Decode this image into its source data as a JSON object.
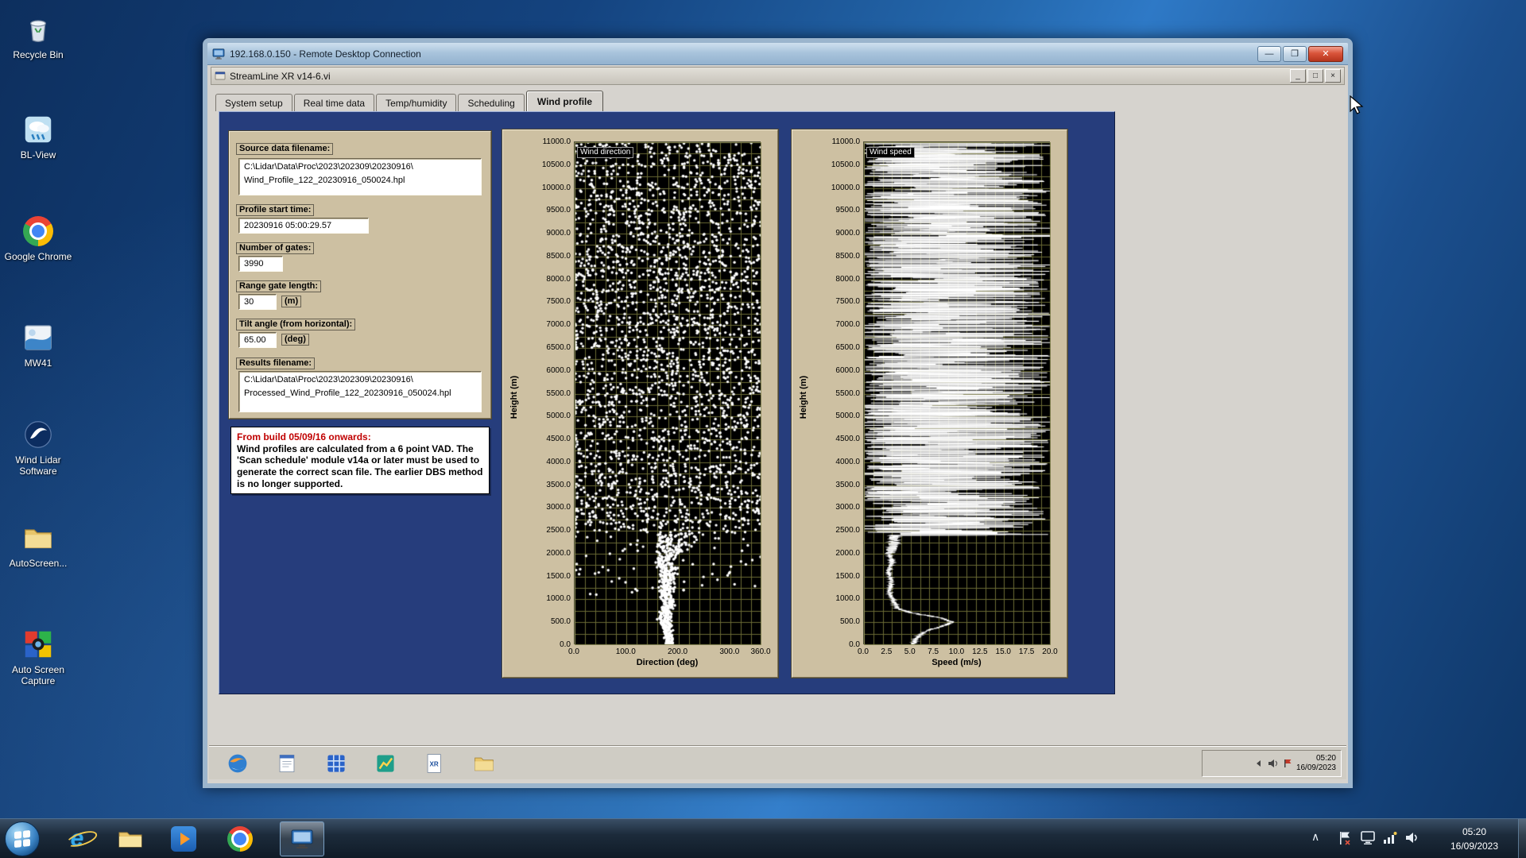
{
  "desktop": {
    "icons": [
      {
        "name": "recycle-bin",
        "label": "Recycle Bin"
      },
      {
        "name": "bl-view",
        "label": "BL-View"
      },
      {
        "name": "google-chrome",
        "label": "Google Chrome"
      },
      {
        "name": "mw41",
        "label": "MW41"
      },
      {
        "name": "wind-lidar-software",
        "label": "Wind Lidar Software"
      },
      {
        "name": "autoscreen",
        "label": "AutoScreen..."
      },
      {
        "name": "auto-screen-capture",
        "label": "Auto Screen Capture"
      }
    ]
  },
  "rdp": {
    "title": "192.168.0.150 - Remote Desktop Connection"
  },
  "app": {
    "title": "StreamLine XR v14-6.vi",
    "tabs": [
      {
        "label": "System setup"
      },
      {
        "label": "Real time data"
      },
      {
        "label": "Temp/humidity"
      },
      {
        "label": "Scheduling"
      },
      {
        "label": "Wind profile"
      }
    ],
    "fields": {
      "source_label": "Source data filename:",
      "source_value": "C:\\Lidar\\Data\\Proc\\2023\\202309\\20230916\\\nWind_Profile_122_20230916_050024.hpl",
      "start_label": "Profile start time:",
      "start_value": "20230916 05:00:29.57",
      "gates_label": "Number of gates:",
      "gates_value": "3990",
      "range_label": "Range gate length:",
      "range_value": "30",
      "range_unit": "(m)",
      "tilt_label": "Tilt angle (from horizontal):",
      "tilt_value": "65.00",
      "tilt_unit": "(deg)",
      "results_label": "Results filename:",
      "results_value": "C:\\Lidar\\Data\\Proc\\2023\\202309\\20230916\\\nProcessed_Wind_Profile_122_20230916_050024.hpl"
    },
    "notice": {
      "heading": "From build 05/09/16 onwards:",
      "body": "Wind profiles are calculated from a 6 point VAD. The 'Scan schedule' module v14a or later must be used to generate the correct scan file. The earlier DBS method is no longer supported."
    }
  },
  "chart_data": [
    {
      "type": "scatter",
      "title": "Wind direction",
      "xlabel": "Direction (deg)",
      "ylabel": "Height (m)",
      "xlim": [
        0,
        360
      ],
      "ylim": [
        0,
        11000
      ],
      "xticks": [
        0,
        100,
        200,
        300,
        360
      ],
      "ytick_step": 500,
      "xgrid_step": 20,
      "ygrid_step": 250,
      "grid": true,
      "description": "Random wind directions 0-360 deg above ~2500 m (noise); coherent column near 170-190 deg below 2500 m down to surface",
      "gen": {
        "seed": 7,
        "n_upper": 2600,
        "upper_min_height": 2450,
        "outliers": 70,
        "column_center": [
          [
            0,
            185
          ],
          [
            300,
            178
          ],
          [
            600,
            172
          ],
          [
            900,
            180
          ],
          [
            1200,
            176
          ],
          [
            1500,
            182
          ],
          [
            1800,
            174
          ],
          [
            2100,
            186
          ],
          [
            2450,
            194
          ]
        ],
        "column_width": [
          [
            0,
            8
          ],
          [
            1000,
            9
          ],
          [
            1500,
            11
          ],
          [
            2000,
            18
          ],
          [
            2450,
            34
          ]
        ]
      }
    },
    {
      "type": "line",
      "title": "Wind speed",
      "xlabel": "Speed (m/s)",
      "ylabel": "Height (m)",
      "xlim": [
        0,
        20
      ],
      "ylim": [
        0,
        11000
      ],
      "xticks": [
        0,
        2.5,
        5,
        7.5,
        10,
        12.5,
        15,
        17.5,
        20
      ],
      "ytick_step": 500,
      "xgrid_step": 1,
      "ygrid_step": 250,
      "grid": true,
      "description": "Noisy speeds spanning 0-20 m/s above ~2400 m; smooth low-level profile ~3 m/s from 800-2400 m peaking ~9.5 m/s near 500 m",
      "gen": {
        "seed": 12,
        "noise_min_height": 2400,
        "step": 4,
        "profile": [
          [
            0,
            5.2
          ],
          [
            150,
            5.6
          ],
          [
            300,
            6.5
          ],
          [
            400,
            8.3
          ],
          [
            500,
            9.4
          ],
          [
            600,
            8.2
          ],
          [
            700,
            5.2
          ],
          [
            800,
            3.6
          ],
          [
            1000,
            3.1
          ],
          [
            1200,
            2.7
          ],
          [
            1400,
            3.0
          ],
          [
            1600,
            2.6
          ],
          [
            1800,
            3.0
          ],
          [
            2000,
            2.8
          ],
          [
            2200,
            3.1
          ],
          [
            2400,
            3.3
          ]
        ]
      }
    }
  ],
  "remote_taskbar": {
    "time": "05:20",
    "date": "16/09/2023"
  },
  "host_taskbar": {
    "time": "05:20",
    "date": "16/09/2023"
  },
  "colors": {
    "panel_blue": "#263d7c",
    "tan": "#cdc0a2",
    "grid": "#6b6b35",
    "dots": "#ffffff",
    "notice_red": "#c00000"
  }
}
